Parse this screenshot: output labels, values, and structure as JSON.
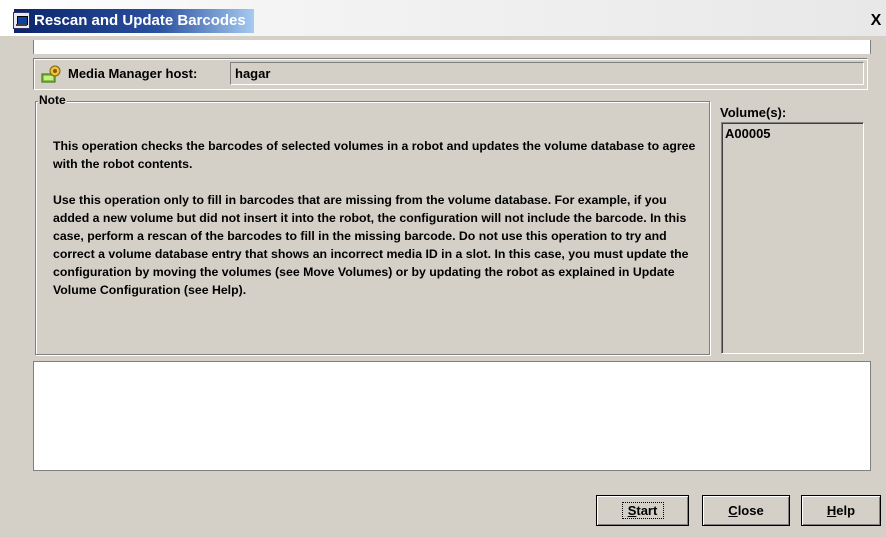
{
  "window": {
    "title": "Rescan and Update Barcodes",
    "close_glyph": "X"
  },
  "host": {
    "label": "Media Manager host:",
    "value": "hagar",
    "icon": "host-settings-icon"
  },
  "note": {
    "legend": "Note",
    "paragraph1": "This operation checks the barcodes of selected volumes in a robot and updates the volume database to agree with the robot contents.",
    "paragraph2": "Use this operation only to fill in barcodes that are missing from the volume database. For example, if you added a new volume but did not insert it into the robot, the configuration will not include the barcode. In this case, perform a rescan of the barcodes to fill in the missing barcode.  Do not use this operation to try and correct a volume database entry that shows an incorrect media ID in a slot. In this case, you must update the configuration by moving the volumes (see Move Volumes) or by updating the robot as explained in Update Volume Configuration (see Help)."
  },
  "volumes": {
    "label": "Volume(s):",
    "items": [
      "A00005"
    ]
  },
  "buttons": {
    "start": {
      "mnemonic": "S",
      "rest": "tart"
    },
    "close": {
      "mnemonic": "C",
      "rest": "lose"
    },
    "help": {
      "mnemonic": "H",
      "rest": "elp"
    }
  }
}
